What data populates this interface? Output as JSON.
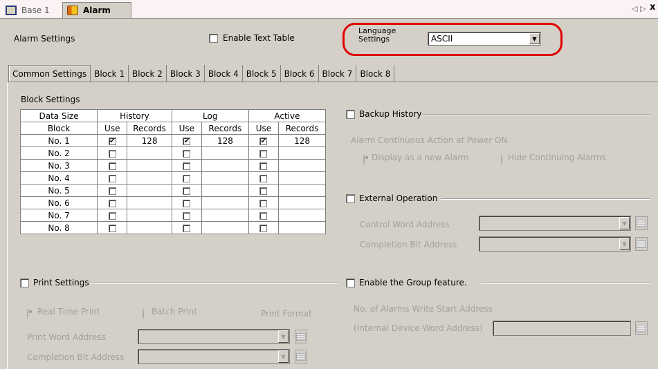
{
  "tabs": {
    "base_label": "Base 1",
    "alarm_label": "Alarm",
    "nav_prev": "◁",
    "nav_next": "▷",
    "close": "x"
  },
  "header": {
    "title": "Alarm Settings",
    "enable_text_table": "Enable Text Table",
    "language_label_line1": "Language",
    "language_label_line2": "Settings",
    "language_value": "ASCII"
  },
  "subtabs": [
    "Common Settings",
    "Block 1",
    "Block 2",
    "Block 3",
    "Block 4",
    "Block 5",
    "Block 6",
    "Block 7",
    "Block 8"
  ],
  "block_settings": {
    "title": "Block Settings",
    "headers_row1": [
      "Data Size",
      "History",
      "Log",
      "Active"
    ],
    "headers_row2": [
      "Block",
      "Use",
      "Records",
      "Use",
      "Records",
      "Use",
      "Records"
    ],
    "rows": [
      {
        "block": "No. 1",
        "h_use": true,
        "h_rec": "128",
        "l_use": true,
        "l_rec": "128",
        "a_use": true,
        "a_rec": "128"
      },
      {
        "block": "No. 2",
        "h_use": false,
        "h_rec": "",
        "l_use": false,
        "l_rec": "",
        "a_use": false,
        "a_rec": ""
      },
      {
        "block": "No. 3",
        "h_use": false,
        "h_rec": "",
        "l_use": false,
        "l_rec": "",
        "a_use": false,
        "a_rec": ""
      },
      {
        "block": "No. 4",
        "h_use": false,
        "h_rec": "",
        "l_use": false,
        "l_rec": "",
        "a_use": false,
        "a_rec": ""
      },
      {
        "block": "No. 5",
        "h_use": false,
        "h_rec": "",
        "l_use": false,
        "l_rec": "",
        "a_use": false,
        "a_rec": ""
      },
      {
        "block": "No. 6",
        "h_use": false,
        "h_rec": "",
        "l_use": false,
        "l_rec": "",
        "a_use": false,
        "a_rec": ""
      },
      {
        "block": "No. 7",
        "h_use": false,
        "h_rec": "",
        "l_use": false,
        "l_rec": "",
        "a_use": false,
        "a_rec": ""
      },
      {
        "block": "No. 8",
        "h_use": false,
        "h_rec": "",
        "l_use": false,
        "l_rec": "",
        "a_use": false,
        "a_rec": ""
      }
    ],
    "check_glyph": "✔"
  },
  "print": {
    "title": "Print Settings",
    "real_time": "Real Time Print",
    "batch": "Batch Print",
    "format": "Print Format",
    "word_address": "Print Word Address",
    "completion_bit": "Completion Bit Address"
  },
  "backup": {
    "title": "Backup History",
    "continuous_label": "Alarm Continuous Action at Power ON",
    "display_new": "Display as a new Alarm",
    "hide_continuing": "Hide Continuing Alarms"
  },
  "external": {
    "title": "External Operation",
    "control_word": "Control Word Address",
    "completion_bit": "Completion Bit Address"
  },
  "group": {
    "title": "Enable the Group feature.",
    "write_start": "No. of Alarms Write Start Address",
    "internal_device": "(Internal Device Word Address)"
  },
  "colors": {
    "highlight": "#e00000",
    "background": "#d4d0c8"
  }
}
